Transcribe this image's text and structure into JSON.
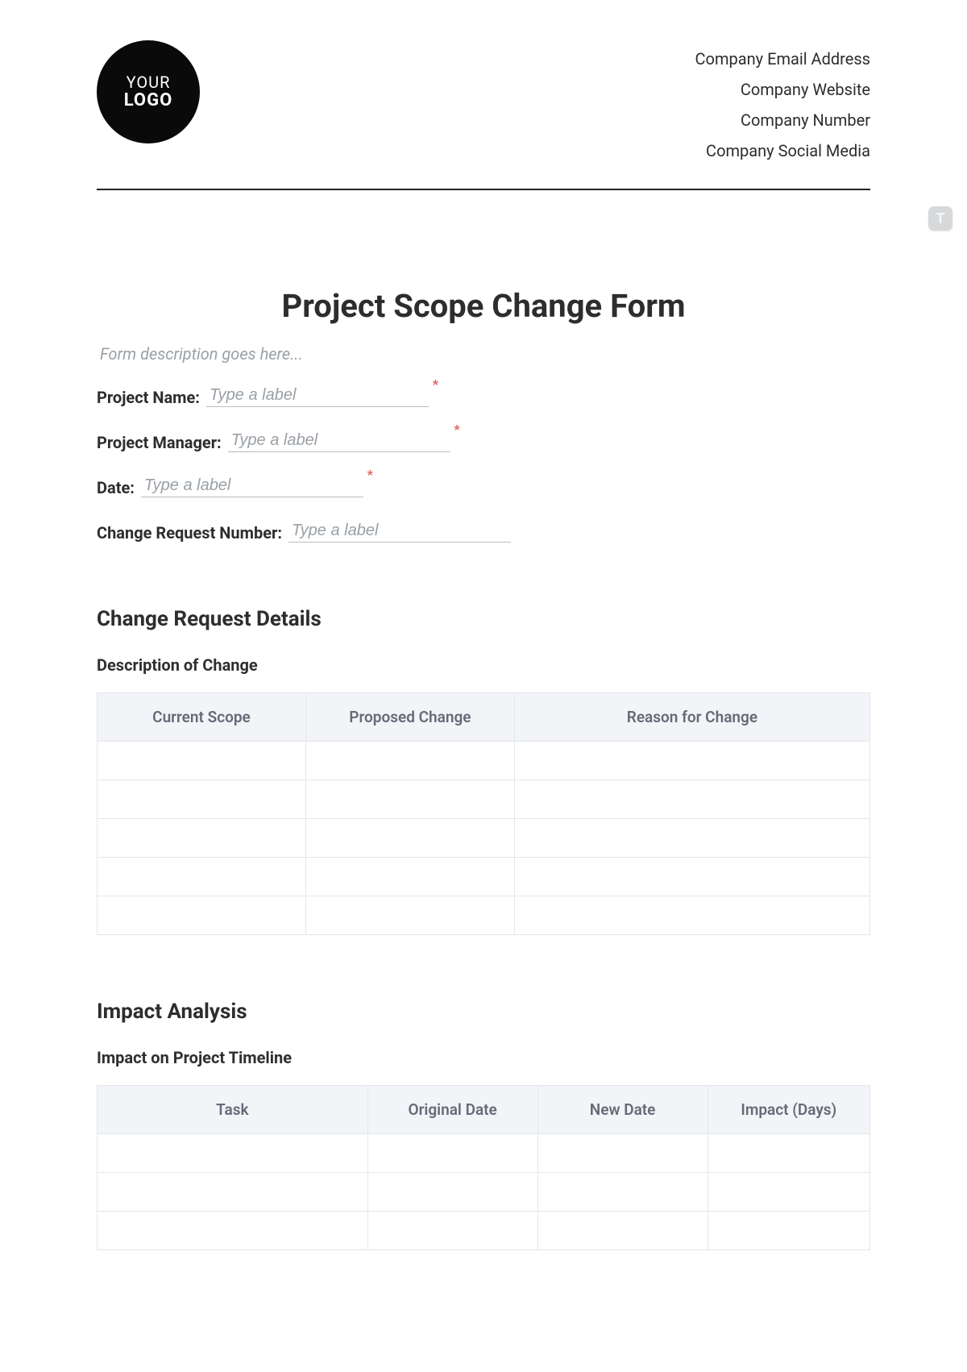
{
  "header": {
    "logo": {
      "line1": "YOUR",
      "line2": "LOGO"
    },
    "company_info": [
      "Company Email Address",
      "Company Website",
      "Company Number",
      "Company Social Media"
    ]
  },
  "badge": {
    "letter": "T"
  },
  "title": "Project Scope Change Form",
  "form_description_placeholder": "Form description goes here...",
  "fields": {
    "project_name": {
      "label": "Project Name:",
      "placeholder": "Type a label",
      "required": true
    },
    "project_manager": {
      "label": "Project Manager:",
      "placeholder": "Type a label",
      "required": true
    },
    "date": {
      "label": "Date:",
      "placeholder": "Type a label",
      "required": true
    },
    "change_req_no": {
      "label": "Change Request Number:",
      "placeholder": "Type a label",
      "required": false
    }
  },
  "section_change_details": {
    "heading": "Change Request Details",
    "subheading": "Description of Change",
    "table": {
      "headers": [
        "Current Scope",
        "Proposed Change",
        "Reason for Change"
      ],
      "row_count": 5
    }
  },
  "section_impact": {
    "heading": "Impact Analysis",
    "subheading": "Impact on Project Timeline",
    "table": {
      "headers": [
        "Task",
        "Original Date",
        "New Date",
        "Impact (Days)"
      ],
      "row_count": 3
    }
  }
}
